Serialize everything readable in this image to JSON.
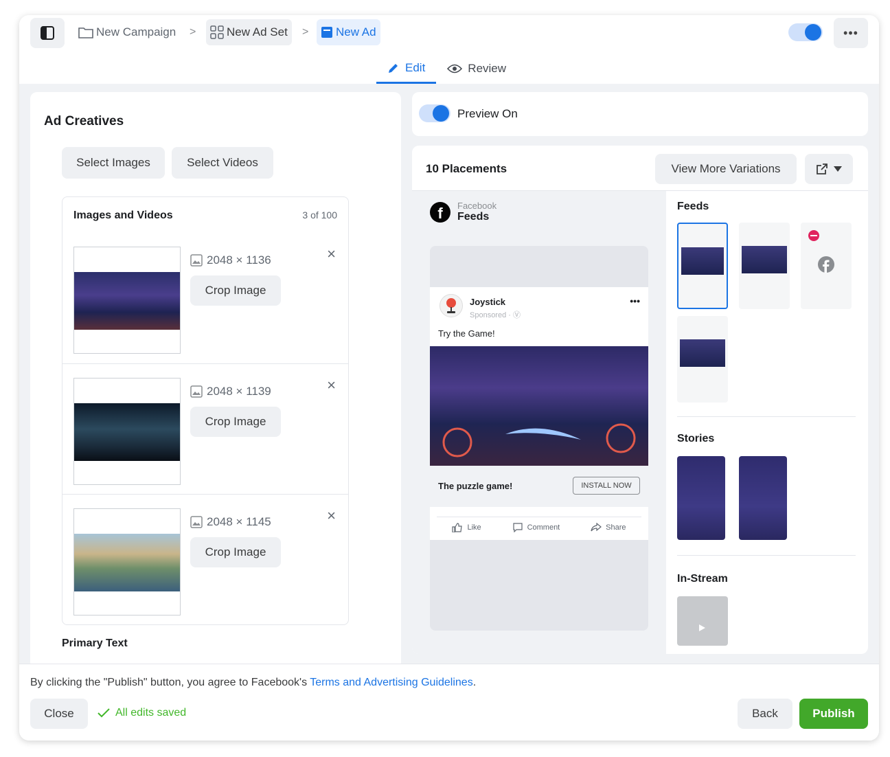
{
  "header": {
    "breadcrumbs": [
      {
        "label": "New Campaign"
      },
      {
        "label": "New Ad Set"
      },
      {
        "label": "New Ad"
      }
    ],
    "separator": ">",
    "more_label": "•••",
    "tabs": [
      {
        "label": "Edit",
        "active": true
      },
      {
        "label": "Review",
        "active": false
      }
    ],
    "accent_color": "#1b74e4"
  },
  "ad_creatives": {
    "title": "Ad Creatives",
    "select_images": "Select Images",
    "select_videos": "Select Videos",
    "media": {
      "title": "Images and Videos",
      "count": "3 of 100",
      "items": [
        {
          "dims": "2048 × 1136",
          "crop_label": "Crop Image",
          "remove": "×"
        },
        {
          "dims": "2048 × 1139",
          "crop_label": "Crop Image",
          "remove": "×"
        },
        {
          "dims": "2048 × 1145",
          "crop_label": "Crop Image",
          "remove": "×"
        }
      ]
    },
    "primary_text_label": "Primary Text"
  },
  "preview": {
    "toggle_label": "Preview On",
    "placements_title": "10 Placements",
    "view_more": "View More Variations",
    "platform": "Facebook",
    "placement": "Feeds",
    "post": {
      "page_name": "Joystick",
      "sponsored": "Sponsored · Ⓥ",
      "more": "•••",
      "text": "Try the Game!",
      "cta_text": "The puzzle game!",
      "cta_button": "INSTALL NOW",
      "like": "Like",
      "comment": "Comment",
      "share": "Share"
    },
    "sections": {
      "feeds": "Feeds",
      "stories": "Stories",
      "instream": "In-Stream"
    }
  },
  "footer": {
    "note_prefix": "By clicking the \"Publish\" button, you agree to Facebook's ",
    "note_link": "Terms and Advertising Guidelines",
    "note_suffix": ".",
    "close_label": "Close",
    "saved_label": "All edits saved",
    "back_label": "Back",
    "publish_label": "Publish",
    "publish_color": "#42a82a"
  }
}
